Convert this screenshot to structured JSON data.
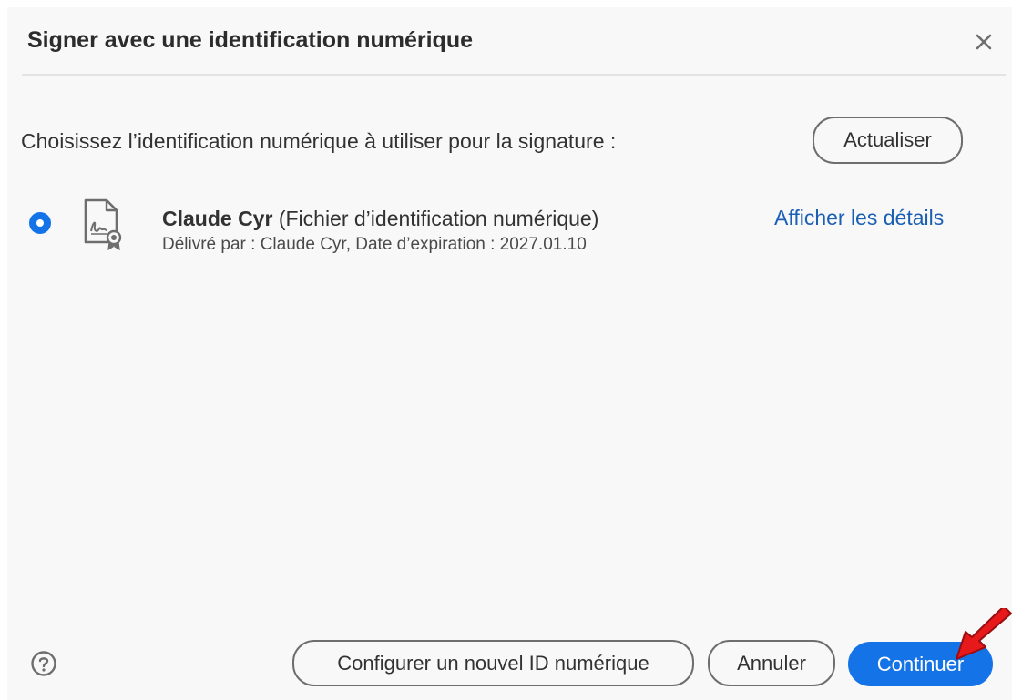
{
  "dialog": {
    "title": "Signer avec une identification numérique",
    "close_icon": "close-icon"
  },
  "prompt": "Choisissez l’identification numérique à utiliser pour la signature :",
  "refresh_label": "Actualiser",
  "identities": [
    {
      "selected": true,
      "icon": "certificate-icon",
      "name": "Claude Cyr",
      "type": "(Fichier d’identification numérique)",
      "issued": "Délivré par : Claude Cyr, Date d’expiration : 2027.01.10",
      "details_label": "Afficher les détails"
    }
  ],
  "footer": {
    "help_icon": "help-icon",
    "configure_label": "Configurer un nouvel ID numérique",
    "cancel_label": "Annuler",
    "continue_label": "Continuer"
  },
  "annotation": {
    "arrow_icon": "red-arrow-icon",
    "color": "#e8191b"
  },
  "colors": {
    "accent": "#1473e6",
    "link": "#1a5fb4",
    "dialog_bg": "#f8f8f8"
  }
}
